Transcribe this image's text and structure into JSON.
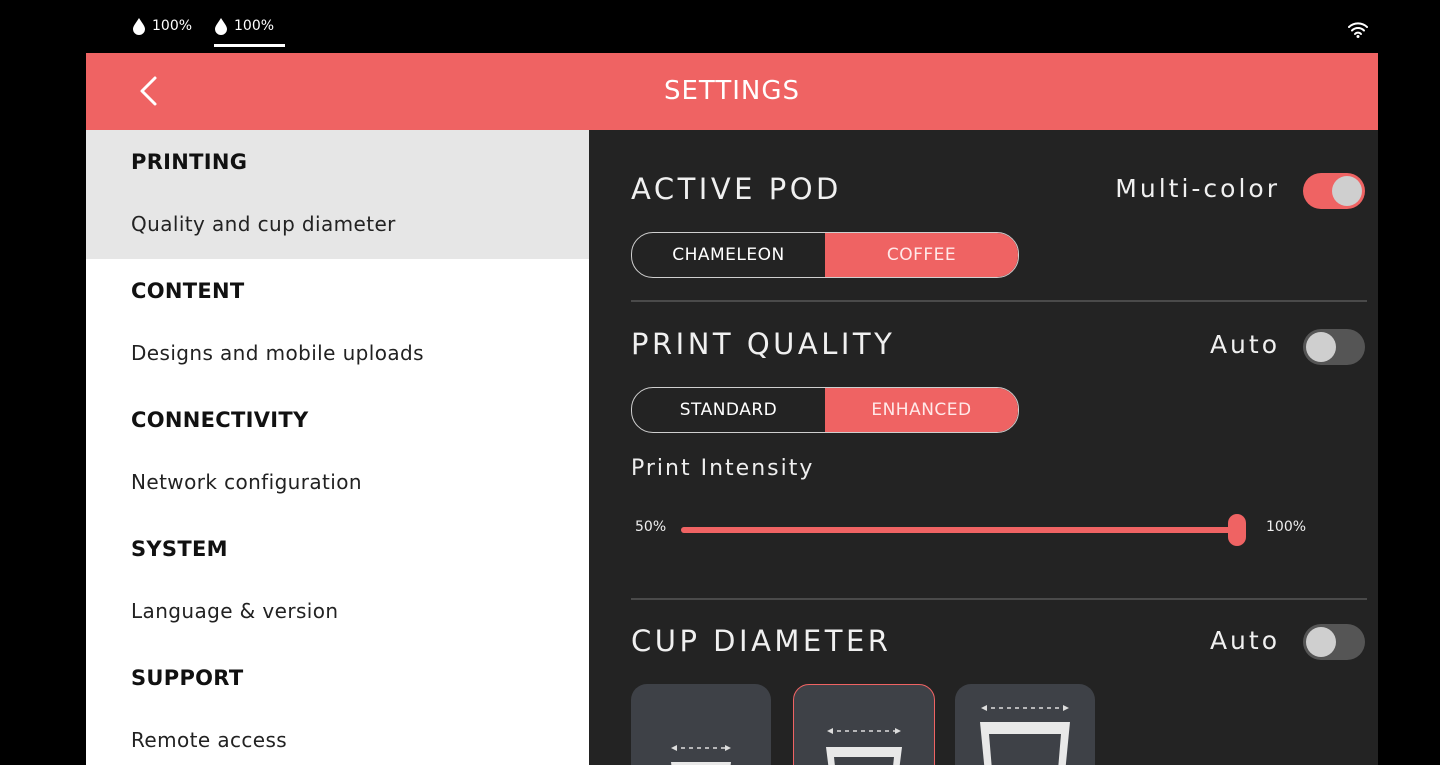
{
  "status_bar": {
    "ink_levels": [
      {
        "label": "100%",
        "icon": "ink-drop-icon"
      },
      {
        "label": "100%",
        "icon": "ink-drop-icon"
      }
    ],
    "wifi_icon": "wifi-icon"
  },
  "header": {
    "title": "SETTINGS",
    "back_icon": "chevron-left-icon",
    "color": "#ef6363"
  },
  "sidebar": {
    "categories": [
      {
        "title": "PRINTING",
        "subtitle": "Quality and cup diameter",
        "active": true
      },
      {
        "title": "CONTENT",
        "subtitle": "Designs and mobile uploads",
        "active": false
      },
      {
        "title": "CONNECTIVITY",
        "subtitle": "Network configuration",
        "active": false
      },
      {
        "title": "SYSTEM",
        "subtitle": "Language & version",
        "active": false
      },
      {
        "title": "SUPPORT",
        "subtitle": "Remote access",
        "active": false
      }
    ]
  },
  "content": {
    "active_pod": {
      "title": "ACTIVE POD",
      "toggle_label": "Multi-color",
      "toggle_on": true,
      "options": [
        "CHAMELEON",
        "COFFEE"
      ],
      "selected": "COFFEE"
    },
    "print_quality": {
      "title": "PRINT QUALITY",
      "toggle_label": "Auto",
      "toggle_on": false,
      "options": [
        "STANDARD",
        "ENHANCED"
      ],
      "selected": "ENHANCED",
      "intensity": {
        "label": "Print Intensity",
        "min_label": "50%",
        "max_label": "100%",
        "value_percent": 100
      }
    },
    "cup_diameter": {
      "title": "CUP DIAMETER",
      "toggle_label": "Auto",
      "toggle_on": false,
      "options": [
        {
          "name": "small-cup",
          "selected": false
        },
        {
          "name": "medium-cup",
          "selected": true
        },
        {
          "name": "large-cup",
          "selected": false
        }
      ]
    }
  },
  "colors": {
    "accent": "#ef6363",
    "panel_dark": "#232323",
    "sidebar_active": "#e6e6e6"
  }
}
